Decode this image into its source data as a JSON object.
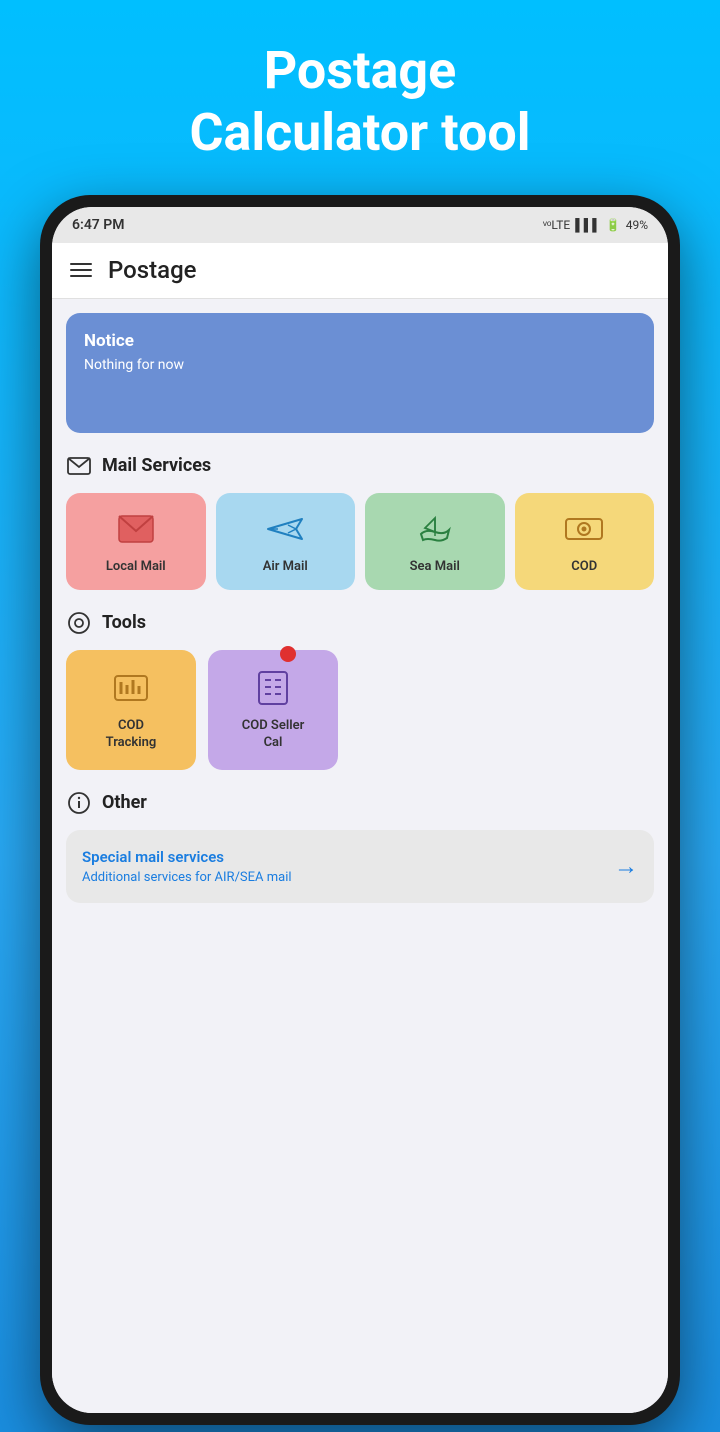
{
  "hero": {
    "title_line1": "Postage",
    "title_line2": "Calculator tool"
  },
  "status_bar": {
    "time": "6:47 PM",
    "battery": "49%"
  },
  "header": {
    "title": "Postage"
  },
  "notice": {
    "title": "Notice",
    "body": "Nothing for now"
  },
  "mail_services": {
    "section_title": "Mail Services",
    "items": [
      {
        "id": "local-mail",
        "label": "Local Mail",
        "color_class": "local"
      },
      {
        "id": "air-mail",
        "label": "Air Mail",
        "color_class": "air"
      },
      {
        "id": "sea-mail",
        "label": "Sea Mail",
        "color_class": "sea"
      },
      {
        "id": "cod",
        "label": "COD",
        "color_class": "cod"
      }
    ]
  },
  "tools": {
    "section_title": "Tools",
    "items": [
      {
        "id": "cod-tracking",
        "label": "COD Tracking",
        "color_class": "cod-tracking"
      },
      {
        "id": "cod-seller",
        "label": "COD Seller Cal",
        "color_class": "cod-seller"
      }
    ]
  },
  "other": {
    "section_title": "Other",
    "special_mail": {
      "title": "Special mail services",
      "subtitle": "Additional services for AIR/SEA mail"
    }
  }
}
